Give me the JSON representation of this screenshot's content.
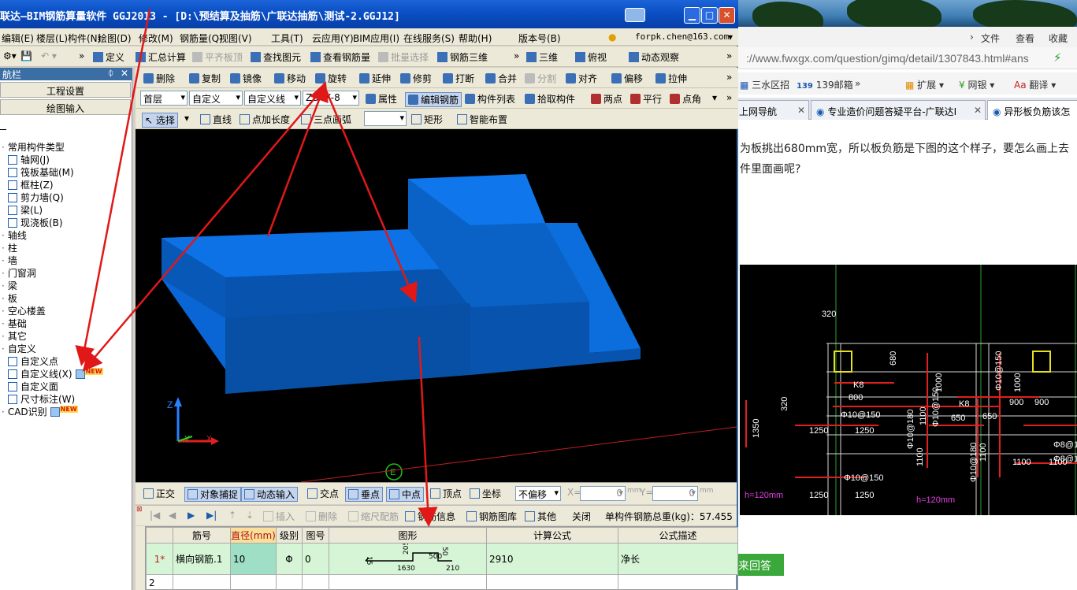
{
  "browser": {
    "menu": {
      "file": "文件",
      "view": "查看",
      "favorites": "收藏"
    },
    "address": "://www.fwxgx.com/question/gimq/detail/1307843.html#ans",
    "bookmarks": [
      "三水区招",
      "139邮箱",
      "扩展",
      "网银",
      "翻译"
    ],
    "tabs": [
      {
        "label": "上网导航"
      },
      {
        "label": "专业造价问题答疑平台-广联达I"
      },
      {
        "label": "异形板负筋该怎"
      }
    ],
    "question_lines": [
      "为板挑出680mm宽，所以板负筋是下图的这个样子，要怎么画上去",
      "件里面画呢?"
    ],
    "reply_button": "来回答",
    "cad": {
      "labels": [
        "320",
        "680",
        "320",
        "K8",
        "800",
        "K8",
        "650",
        "650",
        "900",
        "900",
        "1250",
        "1250",
        "1250",
        "1250",
        "1350",
        "1100",
        "1100",
        "1100",
        "1100",
        "1100",
        "1000",
        "1000",
        "Φ10@150",
        "Φ10@150",
        "Φ10@180",
        "Φ10@150",
        "Φ10@180",
        "Φ10@150",
        "Φ8@150",
        "Φ8@150",
        "h=120mm",
        "h=120mm"
      ]
    }
  },
  "app": {
    "title": "联达—BIM钢筋算量软件 GGJ2013 - [D:\\预结算及抽筋\\广联达抽筋\\测试-2.GGJ12]",
    "menus": [
      "编辑(E)",
      "楼层(L)",
      "构件(N)",
      "绘图(D)",
      "修改(M)",
      "钢筋量(Q)",
      "视图(V)",
      "工具(T)",
      "云应用(Y)",
      "BIM应用(I)",
      "在线服务(S)",
      "帮助(H)",
      "版本号(B)"
    ],
    "account": "forpk.chen@163.com",
    "toolbar1": [
      "定义",
      "汇总计算",
      "平齐板顶",
      "查找图元",
      "查看钢筋量",
      "批量选择",
      "钢筋三维",
      "三维",
      "俯视",
      "动态观察"
    ],
    "toolbar2": [
      "删除",
      "复制",
      "镜像",
      "移动",
      "旋转",
      "延伸",
      "修剪",
      "打断",
      "合并",
      "分割",
      "对齐",
      "偏移",
      "拉伸"
    ],
    "toolbar3": {
      "floor": "首层",
      "type": "自定义",
      "subtype": "自定义线",
      "name": "ZDYX-8",
      "buttons": [
        "属性",
        "编辑钢筋",
        "构件列表",
        "拾取构件",
        "两点",
        "平行",
        "点角"
      ]
    },
    "toolbar4": {
      "select": "选择",
      "tools": [
        "直线",
        "点加长度",
        "三点画弧",
        "矩形",
        "智能布置"
      ]
    },
    "nav": {
      "header": "航栏",
      "pin": "ᛰ",
      "close": "✕",
      "btn_project": "工程设置",
      "btn_draw": "绘图输入",
      "tree": [
        {
          "label": "常用构件类型",
          "level": 0
        },
        {
          "label": "轴网(J)",
          "level": 1
        },
        {
          "label": "筏板基础(M)",
          "level": 1
        },
        {
          "label": "框柱(Z)",
          "level": 1
        },
        {
          "label": "剪力墙(Q)",
          "level": 1
        },
        {
          "label": "梁(L)",
          "level": 1
        },
        {
          "label": "现浇板(B)",
          "level": 1
        },
        {
          "label": "轴线",
          "level": 0
        },
        {
          "label": "柱",
          "level": 0
        },
        {
          "label": "墙",
          "level": 0
        },
        {
          "label": "门窗洞",
          "level": 0
        },
        {
          "label": "梁",
          "level": 0
        },
        {
          "label": "板",
          "level": 0
        },
        {
          "label": "空心楼盖",
          "level": 0
        },
        {
          "label": "基础",
          "level": 0
        },
        {
          "label": "其它",
          "level": 0
        },
        {
          "label": "自定义",
          "level": 0
        },
        {
          "label": "自定义点",
          "level": 1
        },
        {
          "label": "自定义线(X)",
          "level": 1
        },
        {
          "label": "自定义面",
          "level": 1
        },
        {
          "label": "尺寸标注(W)",
          "level": 1
        },
        {
          "label": "CAD识别",
          "level": 0
        }
      ],
      "new_badge": "NEW"
    },
    "viewport": {
      "axis_z": "Z",
      "axis_y": "Y",
      "axis_x": "X",
      "compass": "E"
    },
    "snapbar": {
      "items": [
        "正交",
        "对象捕捉",
        "动态输入",
        "交点",
        "垂点",
        "中点",
        "顶点",
        "坐标"
      ],
      "offset_mode": "不偏移",
      "x_label": "X=",
      "x_val": "0",
      "y_label": "Y=",
      "y_val": "0",
      "unit": "mm"
    },
    "rebarbar": {
      "items": [
        "插入",
        "删除",
        "缩尺配筋",
        "钢筋信息",
        "钢筋图库",
        "其他",
        "关闭"
      ],
      "total": "单构件钢筋总重(kg)：57.455"
    },
    "grid": {
      "headers": [
        "筋号",
        "直径(mm)",
        "级别",
        "图号",
        "图形",
        "计算公式",
        "公式描述"
      ],
      "rows": [
        {
          "index": "1*",
          "name": "横向钢筋.1",
          "dia": "10",
          "grade": "Φ",
          "fig": "0",
          "formula": "2910",
          "desc": "净长",
          "shape": [
            "205",
            "1630",
            "210",
            "500",
            "50",
            "15"
          ]
        },
        {
          "index": "2",
          "name": "",
          "dia": "",
          "grade": "",
          "fig": "",
          "formula": "",
          "desc": "",
          "shape": [
            "",
            "",
            "",
            "",
            "",
            ""
          ]
        }
      ]
    }
  }
}
